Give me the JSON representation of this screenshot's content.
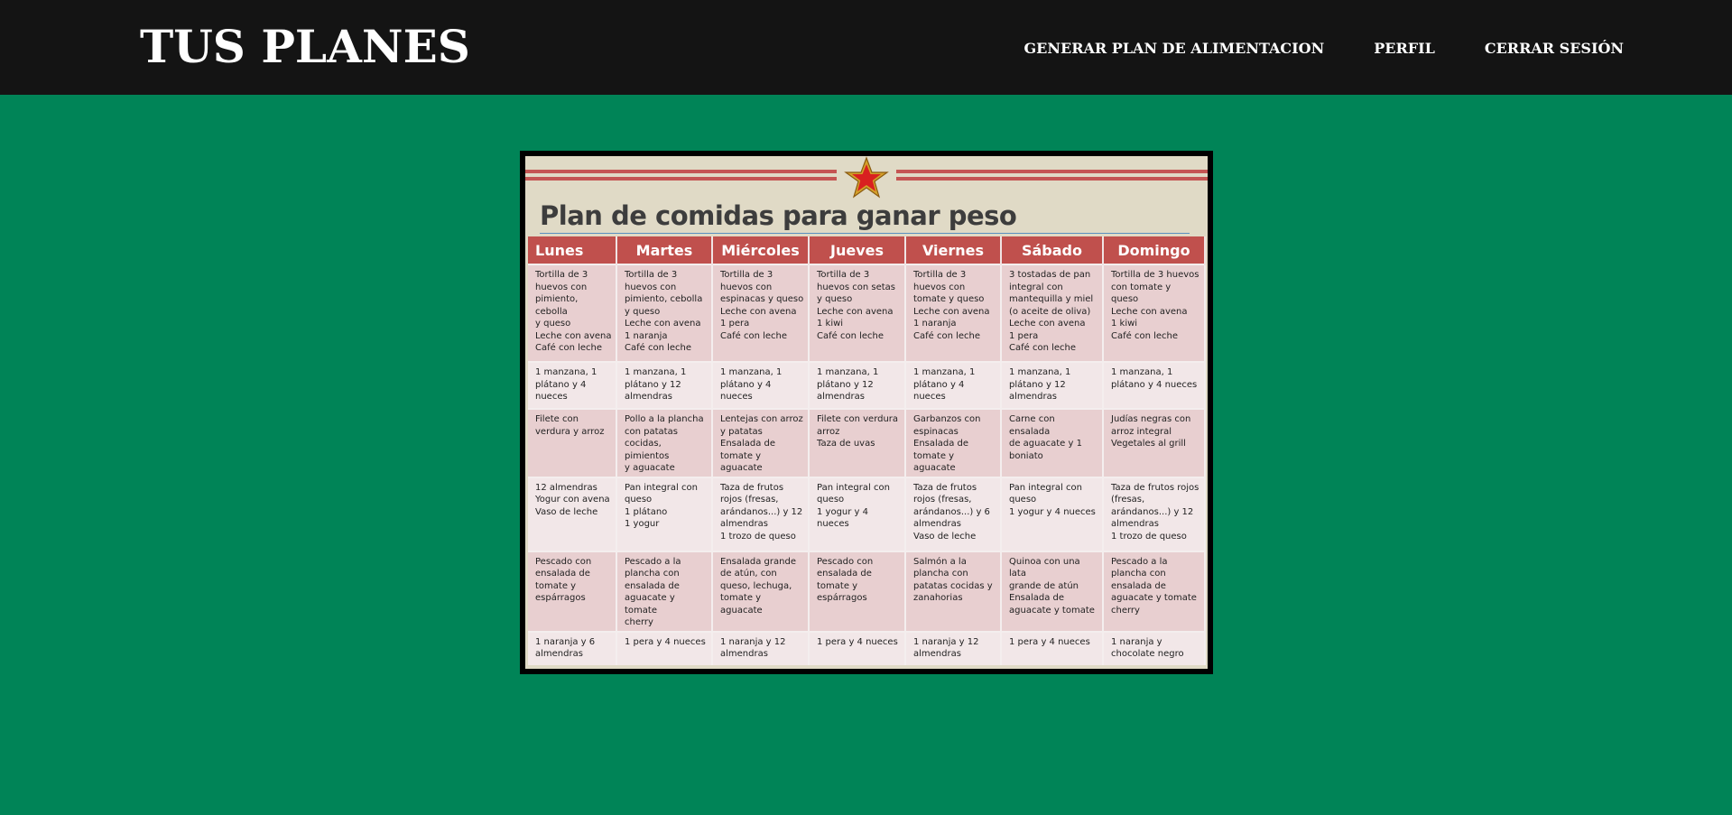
{
  "navbar": {
    "brand": "TUS PLANES",
    "links": [
      "GENERAR PLAN DE ALIMENTACION",
      "PERFIL",
      "CERRAR SESIÓN"
    ]
  },
  "plan": {
    "title": "Plan de comidas para ganar peso",
    "days": [
      "Lunes",
      "Martes",
      "Miércoles",
      "Jueves",
      "Viernes",
      "Sábado",
      "Domingo"
    ],
    "rows": [
      [
        "Tortilla de 3\nhuevos con\npimiento, cebolla\ny queso\nLeche con avena\nCafé con leche",
        "Tortilla de 3\nhuevos con\npimiento, cebolla\ny queso\nLeche con avena\n1 naranja\nCafé con leche",
        "Tortilla de 3\nhuevos con\nespinacas y queso\nLeche con avena\n1 pera\nCafé con leche",
        "Tortilla de 3\nhuevos con setas\ny queso\nLeche con avena\n1 kiwi\nCafé con leche",
        "Tortilla de 3\nhuevos con\ntomate y queso\nLeche con avena\n1 naranja\nCafé con leche",
        "3 tostadas de pan\nintegral con\nmantequilla y miel\n(o aceite de oliva)\nLeche con avena\n1 pera\nCafé con leche",
        "Tortilla de 3 huevos\ncon tomate y queso\nLeche con avena\n1 kiwi\nCafé con leche"
      ],
      [
        "1 manzana, 1\nplátano y 4\nnueces",
        "1 manzana, 1\nplátano y 12\nalmendras",
        "1 manzana, 1\nplátano y 4 nueces",
        "1 manzana, 1\nplátano y 12\nalmendras",
        "1 manzana, 1\nplátano y 4 nueces",
        "1 manzana, 1\nplátano y 12\nalmendras",
        "1 manzana, 1\nplátano y 4 nueces"
      ],
      [
        "Filete con\nverdura y arroz",
        "Pollo a la plancha\ncon patatas\ncocidas, pimientos\ny aguacate",
        "Lentejas con arroz\ny patatas\nEnsalada de\ntomate y aguacate",
        "Filete con verdura\narroz\nTaza de uvas",
        "Garbanzos con\nespinacas\nEnsalada de\ntomate y aguacate",
        "Carne con ensalada\nde aguacate y 1\nboniato",
        "Judías negras con\narroz integral\nVegetales al grill"
      ],
      [
        "12 almendras\nYogur con avena\nVaso de leche",
        "Pan integral con\nqueso\n1 plátano\n1 yogur",
        "Taza de frutos\nrojos (fresas,\narándanos...) y 12\nalmendras\n1 trozo de queso",
        "Pan integral con\nqueso\n1 yogur y 4 nueces",
        "Taza de frutos\nrojos (fresas,\narándanos...) y 6\nalmendras\nVaso de leche",
        "Pan integral con\nqueso\n1 yogur y 4 nueces",
        "Taza de frutos rojos\n(fresas,\narándanos...) y 12\nalmendras\n1 trozo de queso"
      ],
      [
        "Pescado con\nensalada de\ntomate y\nespárragos",
        "Pescado a la\nplancha con\nensalada de\naguacate y tomate\ncherry",
        "Ensalada grande\nde atún, con\nqueso, lechuga,\ntomate y aguacate",
        "Pescado con\nensalada de\ntomate y\nespárragos",
        "Salmón a la\nplancha con\npatatas cocidas y\nzanahorias",
        "Quinoa con una lata\ngrande de atún\nEnsalada de\naguacate y tomate",
        "Pescado a la\nplancha con\nensalada de\naguacate y tomate\ncherry"
      ],
      [
        "1 naranja y 6\nalmendras",
        "1 pera y 4 nueces",
        "1 naranja y 12\nalmendras",
        "1 pera y 4 nueces",
        "1 naranja y 12\nalmendras",
        "1 pera y 4 nueces",
        "1 naranja y\nchocolate negro"
      ]
    ]
  },
  "colors": {
    "page_background": "#008457",
    "navbar_background": "#141414",
    "table_header": "#c0504d",
    "row_dark": "#e8cfd0",
    "row_light": "#f2e7e8"
  },
  "icons": {
    "plan_emblem": "red-star-icon"
  }
}
